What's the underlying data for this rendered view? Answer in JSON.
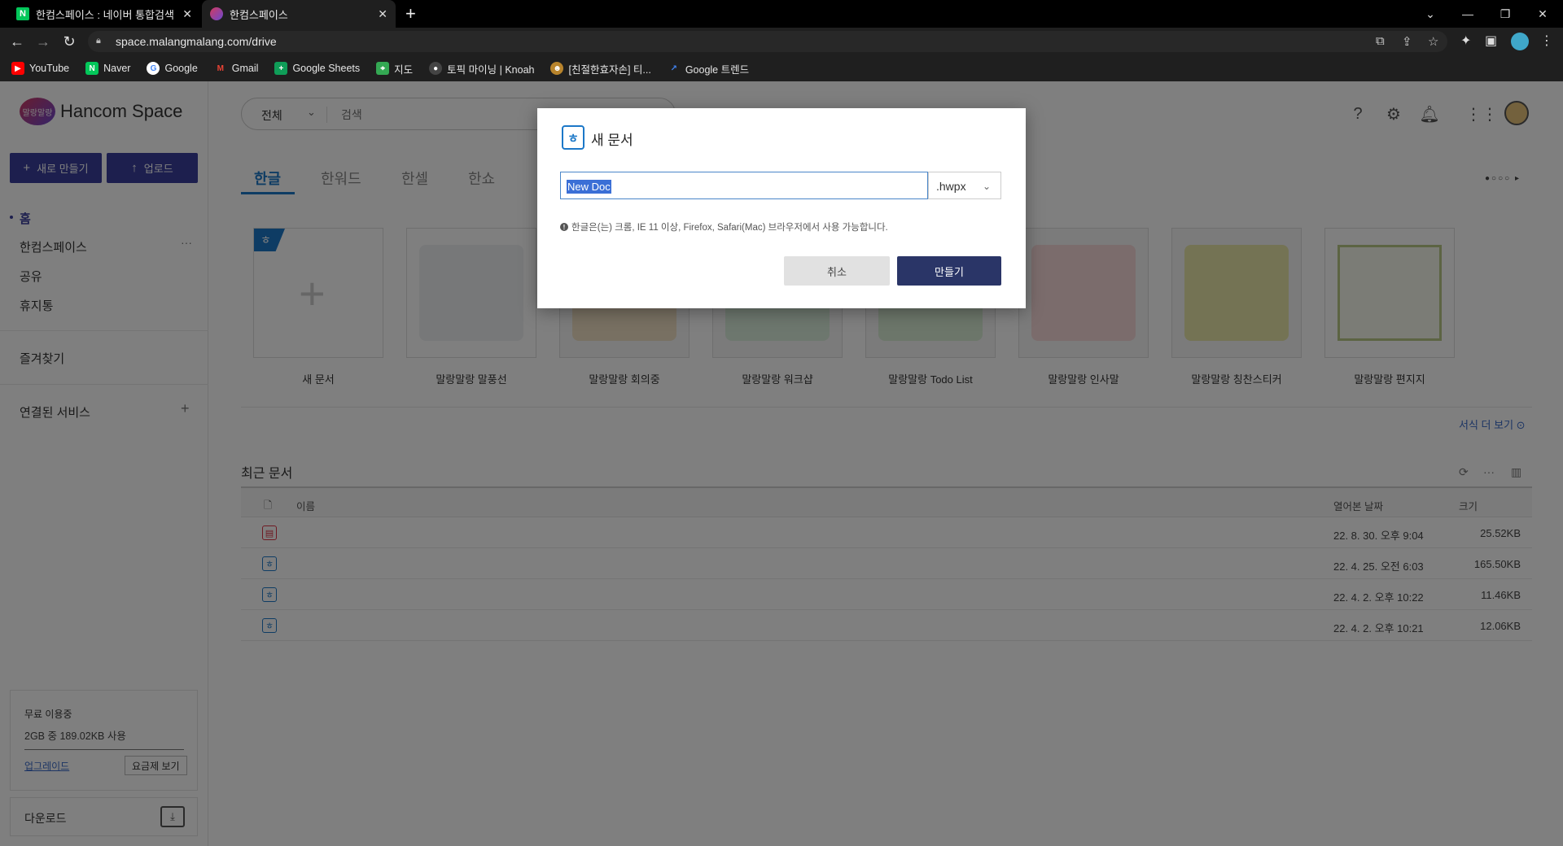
{
  "browser": {
    "tabs": [
      {
        "title": "한컴스페이스 : 네이버 통합검색",
        "favicon": "N"
      },
      {
        "title": "한컴스페이스",
        "favicon": ""
      }
    ],
    "url": "space.malangmalang.com/drive",
    "bookmarks": [
      {
        "label": "YouTube",
        "icon": "youtube-icon",
        "color": "#ff0000"
      },
      {
        "label": "Naver",
        "icon": "naver-icon",
        "color": "#03c75a"
      },
      {
        "label": "Google",
        "icon": "google-icon",
        "color": "#4285f4"
      },
      {
        "label": "Gmail",
        "icon": "gmail-icon",
        "color": "#ea4335"
      },
      {
        "label": "Google Sheets",
        "icon": "sheets-icon",
        "color": "#0f9d58"
      },
      {
        "label": "지도",
        "icon": "maps-icon",
        "color": "#34a853"
      },
      {
        "label": "토픽 마이닝 | Knoah",
        "icon": "knoah-icon",
        "color": "#444444"
      },
      {
        "label": "[친절한효자손] 티...",
        "icon": "tiger-icon",
        "color": "#b8842c"
      },
      {
        "label": "Google 트렌드",
        "icon": "trends-icon",
        "color": "#4285f4"
      }
    ]
  },
  "app": {
    "logo_text": "Hancom Space",
    "logo_badge": "말랑말랑",
    "new_button": "새로 만들기",
    "upload_button": "업로드",
    "sidebar": {
      "home": "홈",
      "hancom_space": "한컴스페이스",
      "shared": "공유",
      "trash": "휴지통",
      "favorites": "즐겨찾기",
      "connected": "연결된 서비스"
    },
    "storage": {
      "title": "무료 이용중",
      "usage": "2GB 중 189.02KB 사용",
      "upgrade": "업그레이드",
      "plans": "요금제 보기"
    },
    "download": "다운로드",
    "search": {
      "scope": "전체",
      "placeholder": "검색"
    },
    "product_tabs": [
      "한글",
      "한워드",
      "한셀",
      "한쇼"
    ],
    "templates": [
      {
        "label": "새 문서"
      },
      {
        "label": "말랑말랑 말풍선"
      },
      {
        "label": "말랑말랑 회의중"
      },
      {
        "label": "말랑말랑 워크샵"
      },
      {
        "label": "말랑말랑 Todo List"
      },
      {
        "label": "말랑말랑 인사말"
      },
      {
        "label": "말랑말랑 칭찬스티커"
      },
      {
        "label": "말랑말랑 편지지"
      }
    ],
    "more_templates": "서식 더 보기",
    "recent_title": "최근 문서",
    "table_headers": {
      "name": "이름",
      "opened": "열어본 날짜",
      "size": "크기"
    },
    "recent_docs": [
      {
        "type": "show",
        "date": "22. 8. 30. 오후 9:04",
        "size": "25.52KB"
      },
      {
        "type": "hwp",
        "date": "22. 4. 25. 오전 6:03",
        "size": "165.50KB"
      },
      {
        "type": "hwp",
        "date": "22. 4. 2. 오후 10:22",
        "size": "11.46KB"
      },
      {
        "type": "hwp",
        "date": "22. 4. 2. 오후 10:21",
        "size": "12.06KB"
      }
    ]
  },
  "modal": {
    "title": "새 문서",
    "filename": "New Doc",
    "extension": ".hwpx",
    "notice": "한글은(는) 크롬, IE 11 이상, Firefox, Safari(Mac) 브라우저에서 사용 가능합니다.",
    "cancel": "취소",
    "create": "만들기"
  },
  "colors": {
    "brand": "#3a3f9c",
    "accent_blue": "#1c78c8",
    "modal_primary": "#2a3567"
  }
}
